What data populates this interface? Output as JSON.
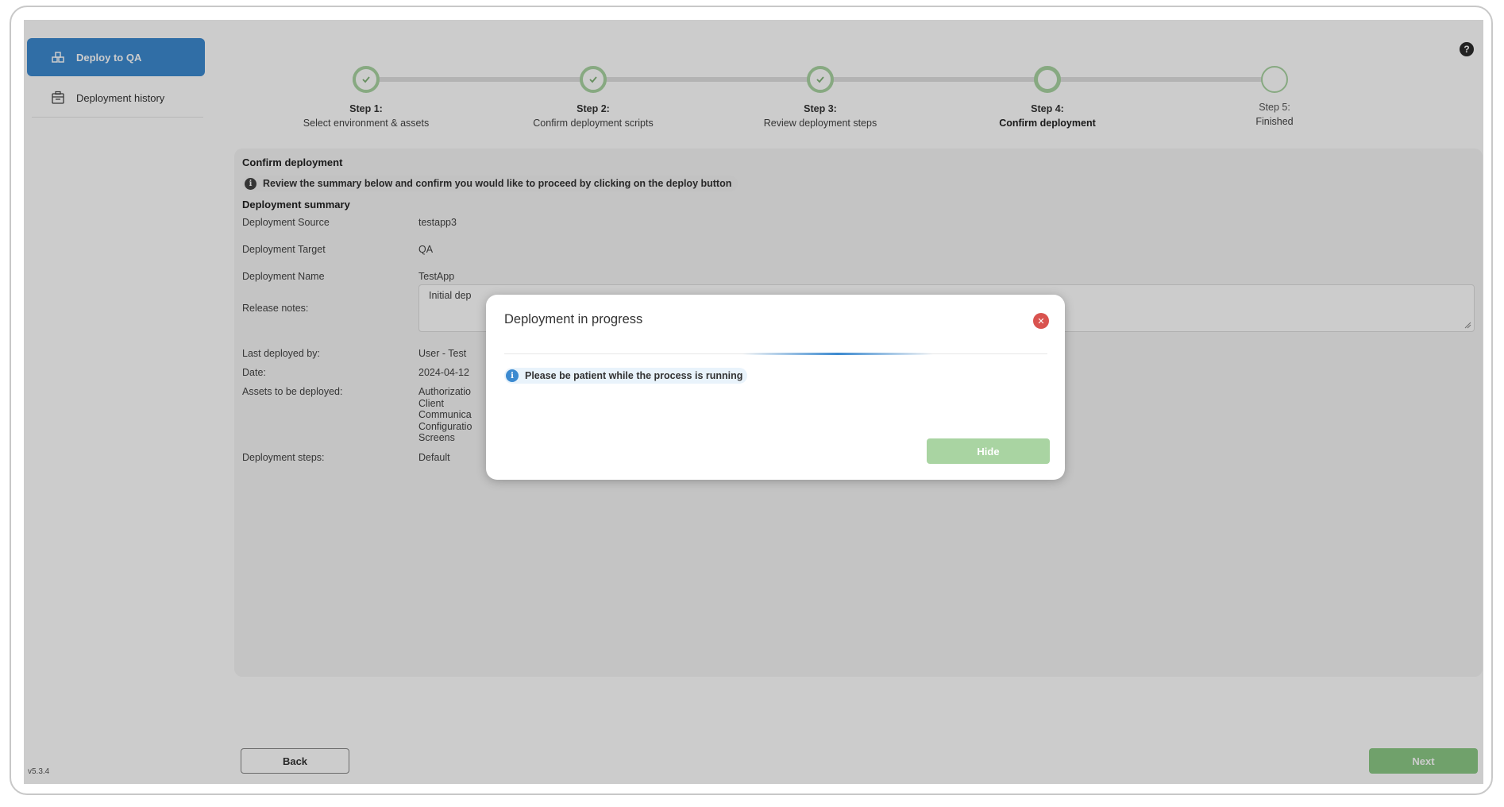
{
  "sidebar": {
    "items": [
      {
        "label": "Deploy to QA",
        "icon": "deploy-icon",
        "active": true
      },
      {
        "label": "Deployment history",
        "icon": "history-icon",
        "active": false
      }
    ],
    "version": "v5.3.4"
  },
  "help_label": "?",
  "stepper": {
    "steps": [
      {
        "title": "Step 1:",
        "subtitle": "Select environment & assets",
        "state": "done"
      },
      {
        "title": "Step 2:",
        "subtitle": "Confirm deployment scripts",
        "state": "done"
      },
      {
        "title": "Step 3:",
        "subtitle": "Review deployment steps",
        "state": "done"
      },
      {
        "title": "Step 4:",
        "subtitle": "Confirm deployment",
        "state": "current"
      },
      {
        "title": "Step 5:",
        "subtitle": "Finished",
        "state": "future"
      }
    ]
  },
  "panel": {
    "title": "Confirm deployment",
    "info": "Review the summary below and confirm you would like to proceed by clicking on the deploy button",
    "summary_title": "Deployment summary",
    "fields": {
      "source_label": "Deployment Source",
      "source_value": "testapp3",
      "target_label": "Deployment Target",
      "target_value": "QA",
      "name_label": "Deployment Name",
      "name_value": "TestApp",
      "notes_label": "Release notes:",
      "notes_value": "Initial dep",
      "last_deployed_label": "Last deployed by:",
      "last_deployed_value": "User - Test",
      "date_label": "Date:",
      "date_value": "2024-04-12",
      "assets_label": "Assets to be deployed:",
      "assets": [
        "Authorizatio",
        "Client",
        "Communica",
        "Configuratio",
        "Screens"
      ],
      "steps_label": "Deployment steps:",
      "steps_value": "Default"
    }
  },
  "buttons": {
    "back": "Back",
    "next": "Next"
  },
  "modal": {
    "title": "Deployment in progress",
    "info": "Please be patient while the process is running",
    "hide": "Hide",
    "close_glyph": "✕"
  },
  "colors": {
    "primary": "#3c8ad0",
    "success": "#a9d4a2",
    "danger": "#d9534f"
  }
}
